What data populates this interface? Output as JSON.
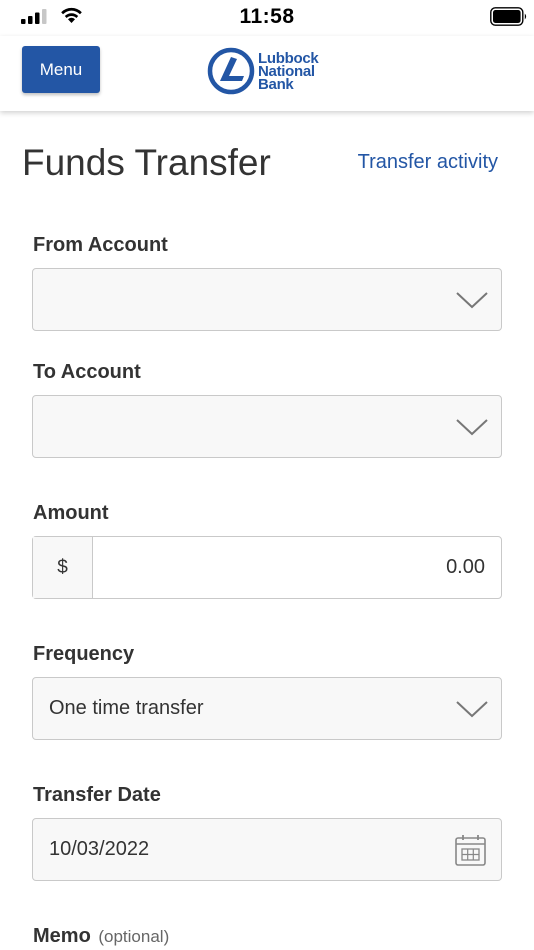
{
  "status_bar": {
    "time": "11:58"
  },
  "header": {
    "menu_label": "Menu",
    "logo": {
      "line1": "Lubbock",
      "line2": "National",
      "line3": "Bank"
    }
  },
  "page": {
    "title": "Funds Transfer",
    "activity_link": "Transfer activity"
  },
  "form": {
    "from_account": {
      "label": "From Account",
      "value": ""
    },
    "to_account": {
      "label": "To Account",
      "value": ""
    },
    "amount": {
      "label": "Amount",
      "prefix": "$",
      "value": "0.00"
    },
    "frequency": {
      "label": "Frequency",
      "value": "One time transfer"
    },
    "transfer_date": {
      "label": "Transfer Date",
      "value": "10/03/2022"
    },
    "memo": {
      "label": "Memo",
      "optional": "(optional)"
    }
  },
  "colors": {
    "brand": "#2356a5",
    "field_bg": "#f8f8f8",
    "field_border": "#c9c9c9"
  },
  "icons": [
    "signal-icon",
    "wifi-icon",
    "battery-icon",
    "logo-mark-icon",
    "chevron-down-icon",
    "calendar-icon"
  ]
}
